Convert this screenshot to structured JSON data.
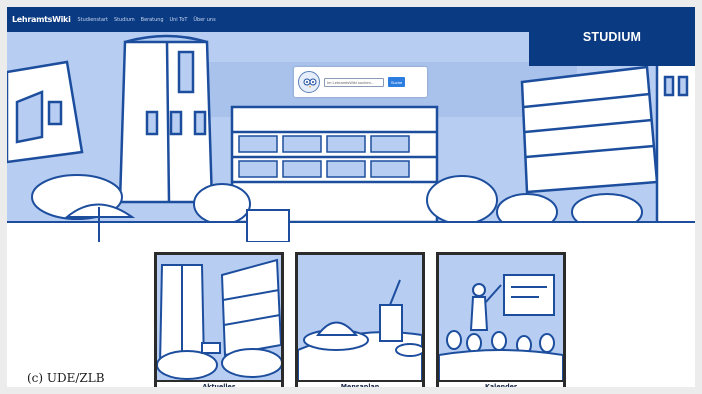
{
  "nav": {
    "brand": "LehramtsWiki",
    "items": [
      "Studienstart",
      "Studium",
      "Beratung",
      "Uni ToT",
      "Über uns"
    ]
  },
  "section_badge": "STUDIUM",
  "search": {
    "placeholder": "Im LehramtsWiki suchen...",
    "button": "Suche"
  },
  "tiles": [
    {
      "label": "Aktuelles"
    },
    {
      "label": "Mensaplan"
    },
    {
      "label": "Kalender"
    }
  ],
  "credit": "(c) UDE/ZLB",
  "colors": {
    "nav_bg": "#0a3a82",
    "hero_sky": "#b7cdf2",
    "line": "#1d4e9e",
    "search_button": "#2b7de0"
  }
}
